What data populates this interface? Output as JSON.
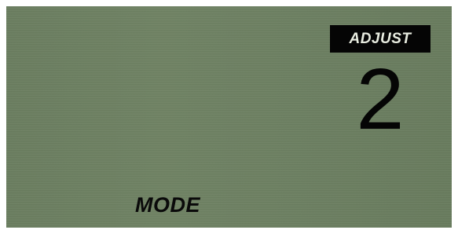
{
  "display": {
    "badge_label": "ADJUST",
    "value": "2",
    "mode_label": "MODE"
  },
  "colors": {
    "screen_background": "#6c7f61",
    "badge_background": "#050505",
    "badge_text": "#e8ece0",
    "segment_text": "#050505"
  }
}
